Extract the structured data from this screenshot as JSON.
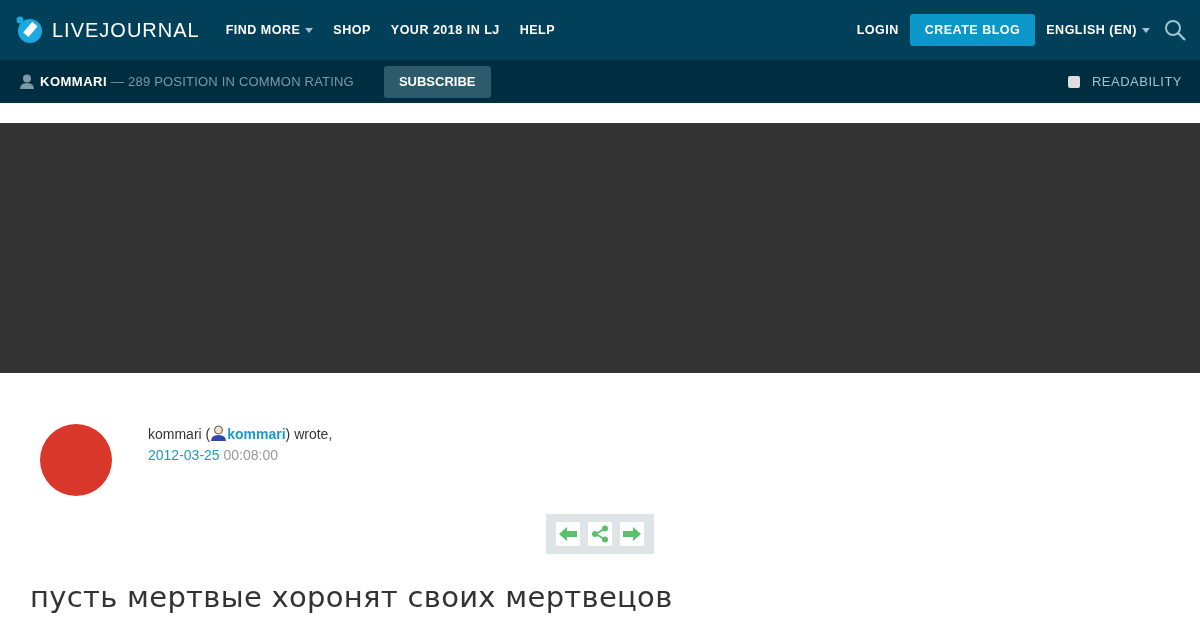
{
  "header": {
    "logo": "LIVEJOURNAL",
    "nav": [
      {
        "label": "FIND MORE",
        "dropdown": true
      },
      {
        "label": "SHOP",
        "dropdown": false
      },
      {
        "label": "YOUR 2018 IN LJ",
        "dropdown": false
      },
      {
        "label": "HELP",
        "dropdown": false
      }
    ],
    "login": "LOGIN",
    "create_blog": "CREATE BLOG",
    "language": "ENGLISH (EN)"
  },
  "subbar": {
    "user": "KOMMARI",
    "rating": "— 289 POSITION IN COMMON RATING",
    "subscribe": "SUBSCRIBE",
    "readability": {
      "label": "READABILITY",
      "checked": false
    }
  },
  "entry": {
    "author": "kommari (",
    "user_link": "kommari",
    "wrote": ") wrote,",
    "date": "2012-03-25",
    "time": "00:08:00",
    "title": "пусть мертвые хоронят своих мертвецов"
  }
}
